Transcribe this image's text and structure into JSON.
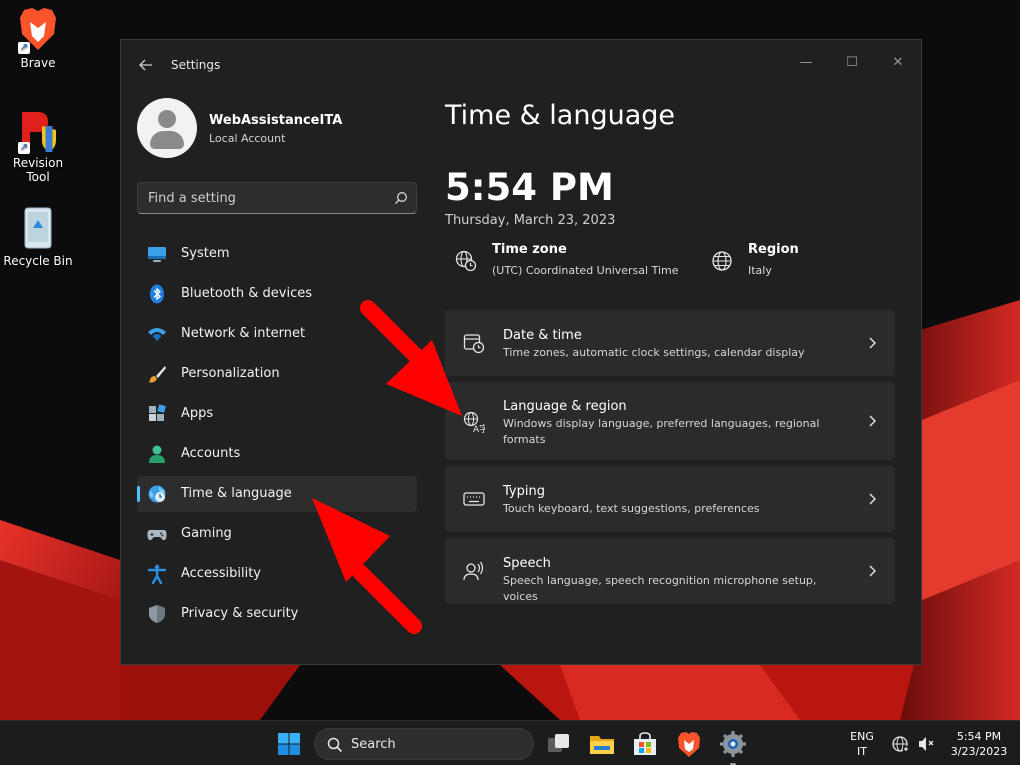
{
  "desktop": {
    "icons": [
      {
        "label": "Brave",
        "icon": "brave-icon"
      },
      {
        "label": "Revision Tool",
        "icon": "revision-tool-icon"
      },
      {
        "label": "Recycle Bin",
        "icon": "recycle-bin-icon"
      }
    ]
  },
  "window": {
    "title": "Settings",
    "controls": {
      "minimize": "—",
      "maximize": "☐",
      "close": "✕"
    }
  },
  "profile": {
    "name": "WebAssistanceITA",
    "account_type": "Local Account"
  },
  "search": {
    "placeholder": "Find a setting"
  },
  "nav": {
    "items": [
      {
        "label": "System",
        "icon": "system-icon"
      },
      {
        "label": "Bluetooth & devices",
        "icon": "bluetooth-icon"
      },
      {
        "label": "Network & internet",
        "icon": "wifi-icon"
      },
      {
        "label": "Personalization",
        "icon": "brush-icon"
      },
      {
        "label": "Apps",
        "icon": "apps-icon"
      },
      {
        "label": "Accounts",
        "icon": "accounts-icon"
      },
      {
        "label": "Time & language",
        "icon": "time-language-icon",
        "active": true
      },
      {
        "label": "Gaming",
        "icon": "gamepad-icon"
      },
      {
        "label": "Accessibility",
        "icon": "accessibility-icon"
      },
      {
        "label": "Privacy & security",
        "icon": "shield-icon"
      }
    ]
  },
  "main": {
    "page_title": "Time & language",
    "current_time": "5:54 PM",
    "current_date": "Thursday, March 23, 2023",
    "time_zone": {
      "label": "Time zone",
      "value": "(UTC) Coordinated Universal Time"
    },
    "region": {
      "label": "Region",
      "value": "Italy"
    },
    "cards": [
      {
        "title": "Date & time",
        "description": "Time zones, automatic clock settings, calendar display",
        "icon": "clock-calendar-icon"
      },
      {
        "title": "Language & region",
        "description": "Windows display language, preferred languages, regional formats",
        "icon": "language-icon"
      },
      {
        "title": "Typing",
        "description": "Touch keyboard, text suggestions, preferences",
        "icon": "keyboard-icon"
      },
      {
        "title": "Speech",
        "description": "Speech language, speech recognition microphone setup, voices",
        "icon": "speech-icon"
      }
    ]
  },
  "taskbar": {
    "search_label": "Search",
    "language": {
      "line1": "ENG",
      "line2": "IT"
    },
    "clock": {
      "time": "5:54 PM",
      "date": "3/23/2023"
    }
  },
  "colors": {
    "accent": "#4cc2ff",
    "window_bg": "#202020",
    "card_bg": "#2b2b2b",
    "annotation_arrow": "#ff0000"
  }
}
